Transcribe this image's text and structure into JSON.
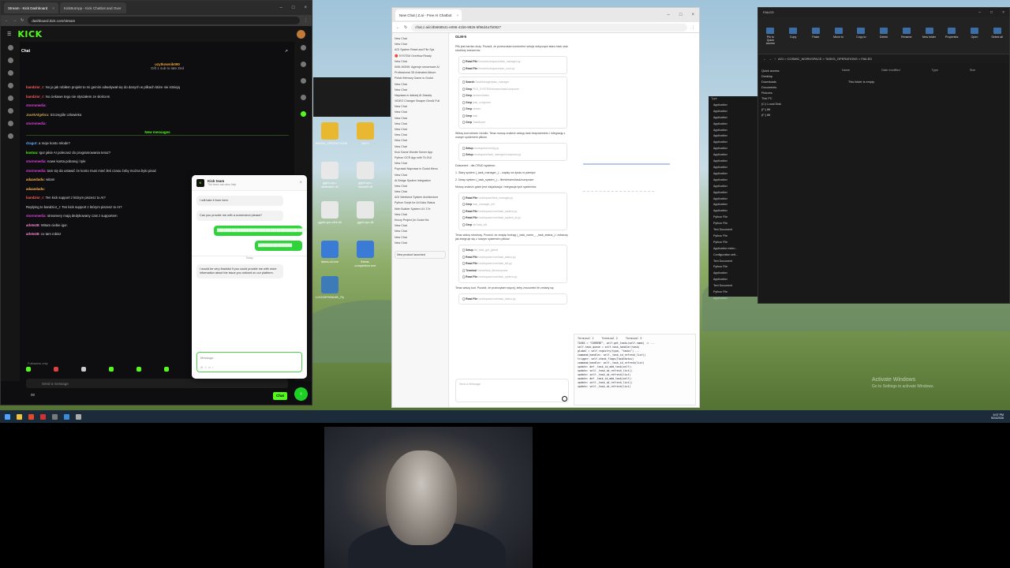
{
  "kick": {
    "tabs": [
      {
        "label": "Stream - Kick Dashboard",
        "active": true
      },
      {
        "label": "KickBotApp - Kick Chatbot and Over",
        "active": false
      }
    ],
    "url": "dashboard.kick.com/stream",
    "logo": "KICK",
    "chat_title": "Chat",
    "gift_user": "uzytkownik090",
    "gift_text": "Gift 1 sub to tate Zed",
    "messages": [
      {
        "user": "bandzior_r:",
        "text": "No ja jak robiłem projekt to mi gemini odwoływał się do danych w plikach które nie istnieją",
        "color": "#ff5f5f"
      },
      {
        "user": "bandzior_r:",
        "text": "No ciekawe tego nie słyszałem ze słońcem",
        "color": "#ff5f5f"
      },
      {
        "user": "stormmedia:",
        "text": "",
        "color": "#e040e0"
      },
      {
        "user": "JacekAlgebra:",
        "text": "Szczególe człowieka",
        "color": "#c9a84f"
      },
      {
        "user": "stormmedia:",
        "text": "",
        "color": "#e040e0"
      }
    ],
    "new_messages_label": "New messages",
    "messages_after": [
      {
        "user": "dragut:",
        "text": "a moje konto młode?",
        "color": "#5fa7ff"
      },
      {
        "user": "kostoa:",
        "text": "Igor jakie AI polecasz do programowania teraz?",
        "color": "#53fc18"
      },
      {
        "user": "stormmedia:",
        "text": "nowe konta pobanuj i tyle",
        "color": "#e040e0"
      },
      {
        "user": "stormmedia:",
        "text": "tam się da ustawić że konto musi mieć ileś czasu żeby można było pisać",
        "color": "#e040e0"
      },
      {
        "user": "adaasdadu:",
        "text": "witam",
        "color": "#ffb347"
      },
      {
        "user": "adaasdadu:",
        "text": "",
        "color": "#ffb347"
      },
      {
        "user": "bandzior_r:",
        "text": "Ten kick support z którym piszesz to AI?",
        "color": "#ff5f5f"
      },
      {
        "user": "",
        "text": "Replying to bandzior_r: Ten kick support z którym piszesz to AI?",
        "color": "#888888"
      },
      {
        "user": "stormmedia:",
        "text": "streamery mają dedykowany czat z supportem",
        "color": "#e040e0"
      },
      {
        "user": "arlete28:",
        "text": "Witam ciebie igor.",
        "color": "#ff8ad8"
      },
      {
        "user": "arlete28:",
        "text": "co tam robisz",
        "color": "#ff8ad8"
      }
    ],
    "followers_only": "Followers only",
    "send_placeholder": "Send a message",
    "viewer_count": "00",
    "chat_button": "Chat"
  },
  "popup": {
    "title": "Kick team",
    "subtitle": "The team can also help",
    "messages": [
      {
        "side": "left",
        "text": "I will take it from here."
      },
      {
        "side": "left",
        "text": "Can you provide me with a screenshot please?"
      },
      {
        "side": "right",
        "text": "████████████████████████████████████████████████████"
      },
      {
        "side": "right",
        "text": "████████████████"
      },
      {
        "side": "left",
        "text": "I would be very thankful if you could provide me with more information about the issue you noticed on our platform."
      }
    ],
    "divider": "Today",
    "input_placeholder": "Message..."
  },
  "zai": {
    "tabs": [
      {
        "label": "New Chat | Z.ai - Free AI Chatbot",
        "active": true
      }
    ],
    "url": "chat.z.ai/c/d5668541-e096-41b6-9825-5f96d4a7b0927",
    "model": "GLM-5",
    "sidebar": [
      "New Chat",
      "New Chat",
      "AGI System Reset and File Sys",
      "🔴 SYSTEM Overflow Ready",
      "New Chat",
      "KIMI-MONK: Agencje serwerowe AI",
      "Professional 3D Animated Album",
      "Polski Memory Game w Godot",
      "New Chat",
      "New Chat",
      "Naprawa w dalszej AI Zasady",
      "VIDEO Changer Swaper GenAI Full",
      "New Chat",
      "New Chat",
      "New Chat",
      "New Chat",
      "New Chat",
      "New Chat",
      "New Chat",
      "New Chat",
      "Kick Game Wordle Solver App",
      "Python OCR App with Tk GUI",
      "New Chat",
      "Poprawki Naprawa in Godot Menu",
      "New Chat",
      "AI Bridge System Integration",
      "New Chat",
      "New Chat",
      "AGI Weekend System Architecture",
      "Python Script for Ai Kicks Status",
      "Web Builder System UX 17e",
      "New Chat",
      "Kezzy Project (in Godot Ha",
      "New Chat",
      "New Chat",
      "New Chat",
      "New Chat"
    ],
    "new_product": "New product launched",
    "paragraphs": [
      "Plik jest bardzo duży. Pozwól, że przeszukam konkretne sekcje dotyczące stanu task oraz struktury stream'ów:",
      "Widzę kod stream i źródło. Teraz muszę znaleźć sekcję task bezpośrednio i integrację z nowym systemem plików.",
      "Dokument - dla CRUD systemu:",
      "1. Stary system (_task_manager_) – zapisy na dysku w pamięci",
      "2. Nowy system (_task_system_) – file/streams/task/composer",
      "Muszę znaleźć gdzie jest inicjalizacja i integracja tych systemów:",
      "Teraz widzę strukturę. Pozwól, że znajdę funkcję (_task_name_, _task_status_) i zobaczę jak integruje się z nowym systemem plików:",
      "Teraz widzę kod. Pozwól, że przeczytam więcej, żeby zrozumieć ile zmiany są:"
    ],
    "tool_rows": [
      [
        "Read File",
        "/home/workspace/task_manager.py"
      ],
      [
        "Read File",
        "/home/workspace/aim_core.py"
      ],
      [
        "Search",
        "TaskManager|task_manager"
      ],
      [
        "Grep",
        "FILE_SYSTEM/streams/task/composer"
      ],
      [
        "Grep",
        "streams/tasks"
      ],
      [
        "Grep",
        "task_composer"
      ],
      [
        "Grep",
        "stream"
      ],
      [
        "Grep",
        "task"
      ],
      [
        "Grep",
        "TaskBoard"
      ],
      [
        "Setup",
        "/workspace/config.py"
      ],
      [
        "Setup",
        "/workspace/task_manager/composer.py"
      ],
      [
        "Read File",
        "/workspace/task_manager.py"
      ],
      [
        "Grep",
        "task_manager_init"
      ],
      [
        "Read File",
        "/workspace/core/task_system.py"
      ],
      [
        "Read File",
        "/workspace/core/task_system_ai.py"
      ],
      [
        "Grep",
        "def task_init"
      ],
      [
        "Setup",
        "def_task_get_global"
      ],
      [
        "Read File",
        "/workspace/core/task_status.py"
      ],
      [
        "Read File",
        "/workspace/core/task_list.py"
      ],
      [
        "Terminal",
        "/home/task_file/composer"
      ],
      [
        "Read File",
        "/workspace/core/task_system.py"
      ],
      [
        "Read File",
        "/workspace/core/task_status.py"
      ],
      [
        "Read File",
        "/workspace/core/task_manager.py"
      ]
    ],
    "terminal_tabs": [
      "Terminal 1",
      "Terminal 2",
      "Terminal 3"
    ],
    "terminal_lines": [
      "TASKS = \"CURRENT\", self.get_tasks(self.name) -> ...",
      "  self.task_queue = self.task_handler(task)",
      "  global = self.registry(type, \"tasks\") ...",
      "  command_handler: self._task_id_refresh_list()",
      "  trigger:          self.check_flags(TaskStatus)",
      "  command_handler: self._task_id_refresh(list)",
      "  update:    def _task_id_add_task(self):",
      "  update:      self._task_id_refresh_list()",
      "  update:      self._task_id_refresh(list)",
      "  update:    def _task_id_add_task(self):",
      "  update:      self._task_id_refresh_list()",
      "  update:      self._task_id_refresh(list)"
    ],
    "input_placeholder": "Send a Message"
  },
  "explorer": {
    "title": "FAILED",
    "ribbon": [
      "Pin to Quick access",
      "Copy",
      "Paste",
      "Move to",
      "Copy to",
      "Delete",
      "Rename",
      "New folder",
      "Properties",
      "Open",
      "Select all"
    ],
    "path": "AGI > COSMIC_WORKSPACE > TASKS_OPERATIONS > FAILED",
    "columns": [
      "Name",
      "Date modified",
      "Type",
      "Size"
    ],
    "empty_text": "This folder is empty.",
    "nav": [
      "Quick access",
      "Desktop",
      "Downloads",
      "Documents",
      "Pictures",
      "This PC",
      "(C:) Local Disk",
      "(F:) 8tt",
      "(F:) 8tt"
    ]
  },
  "typelist": {
    "header": "Type",
    "items": [
      "Application",
      "Application",
      "Application",
      "Application",
      "Application",
      "Application",
      "Application",
      "Application",
      "Application",
      "Application",
      "Application",
      "Application",
      "Application",
      "Application",
      "Application",
      "Application",
      "Application",
      "Application",
      "Python File",
      "Python File",
      "Text Document",
      "Python File",
      "Python File",
      "Application exten...",
      "Configuration sett...",
      "Text Document",
      "Python File",
      "Application",
      "Application",
      "Text Document",
      "Python File",
      "Application"
    ]
  },
  "desktop_icons": [
    {
      "label": "BRAIN_OPERATIONS",
      "color": "#e8b830"
    },
    {
      "label": "INFO",
      "color": "#e8b830"
    },
    {
      "label": "ggml-cpu-alderlake.dll",
      "color": "#e8e8e8"
    },
    {
      "label": "ggml-cpu-haswell.dll",
      "color": "#e8e8e8"
    },
    {
      "label": "ggml-cpu-x64.dll",
      "color": "#e8e8e8"
    },
    {
      "label": "ggml-rpc.dll",
      "color": "#e8e8e8"
    },
    {
      "label": "llama-cli.exe",
      "color": "#3a7bd5"
    },
    {
      "label": "llama-completion.exe",
      "color": "#3a7bd5"
    },
    {
      "label": "LOGGER/BANK_Py",
      "color": "#3d7ab8"
    }
  ],
  "taskbar": {
    "time": "6:07 PM",
    "date": "5/24/2026"
  },
  "watermark": [
    "Activate Windows",
    "Go to Settings to activate Windows."
  ]
}
